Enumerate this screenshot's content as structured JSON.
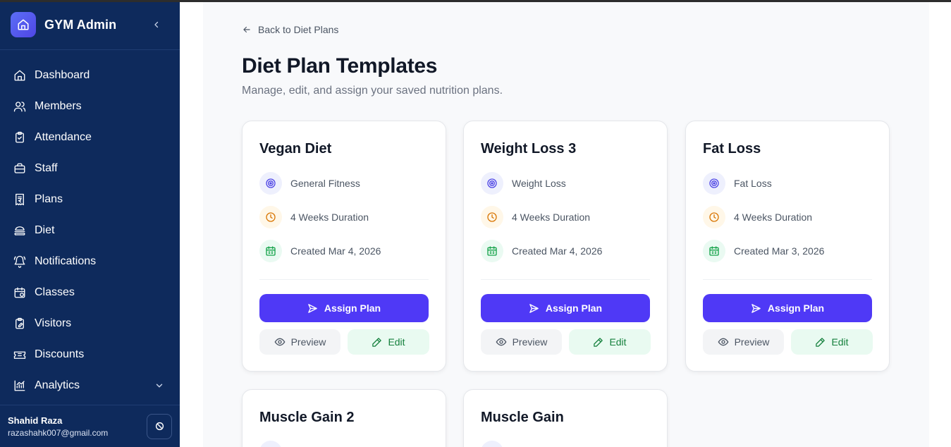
{
  "app": {
    "title": "GYM Admin"
  },
  "sidebar": {
    "items": [
      {
        "label": "Dashboard",
        "icon": "home-icon"
      },
      {
        "label": "Members",
        "icon": "users-icon"
      },
      {
        "label": "Attendance",
        "icon": "clipboard-check-icon"
      },
      {
        "label": "Staff",
        "icon": "briefcase-icon"
      },
      {
        "label": "Plans",
        "icon": "receipt-rupee-icon"
      },
      {
        "label": "Diet",
        "icon": "burger-icon"
      },
      {
        "label": "Notifications",
        "icon": "bell-icon"
      },
      {
        "label": "Classes",
        "icon": "calendar-icon"
      },
      {
        "label": "Visitors",
        "icon": "clipboard-pen-icon"
      },
      {
        "label": "Discounts",
        "icon": "ticket-icon"
      },
      {
        "label": "Analytics",
        "icon": "chart-icon"
      }
    ]
  },
  "user": {
    "name": "Shahid Raza",
    "email": "razashahk007@gmail.com"
  },
  "page": {
    "back_label": "Back to Diet Plans",
    "title": "Diet Plan Templates",
    "subtitle": "Manage, edit, and assign your saved nutrition plans."
  },
  "cards": [
    {
      "title": "Vegan Diet",
      "goal": "General Fitness",
      "duration": "4 Weeks Duration",
      "created": "Created Mar 4, 2026",
      "assign": "Assign Plan",
      "preview": "Preview",
      "edit": "Edit"
    },
    {
      "title": "Weight Loss 3",
      "goal": "Weight Loss",
      "duration": "4 Weeks Duration",
      "created": "Created Mar 4, 2026",
      "assign": "Assign Plan",
      "preview": "Preview",
      "edit": "Edit"
    },
    {
      "title": "Fat Loss",
      "goal": "Fat Loss",
      "duration": "4 Weeks Duration",
      "created": "Created Mar 3, 2026",
      "assign": "Assign Plan",
      "preview": "Preview",
      "edit": "Edit"
    },
    {
      "title": "Muscle Gain 2"
    },
    {
      "title": "Muscle Gain"
    }
  ],
  "colors": {
    "sidebar_bg": "#0e2a5c",
    "primary": "#4f39f6",
    "edit_text": "#15803d"
  }
}
